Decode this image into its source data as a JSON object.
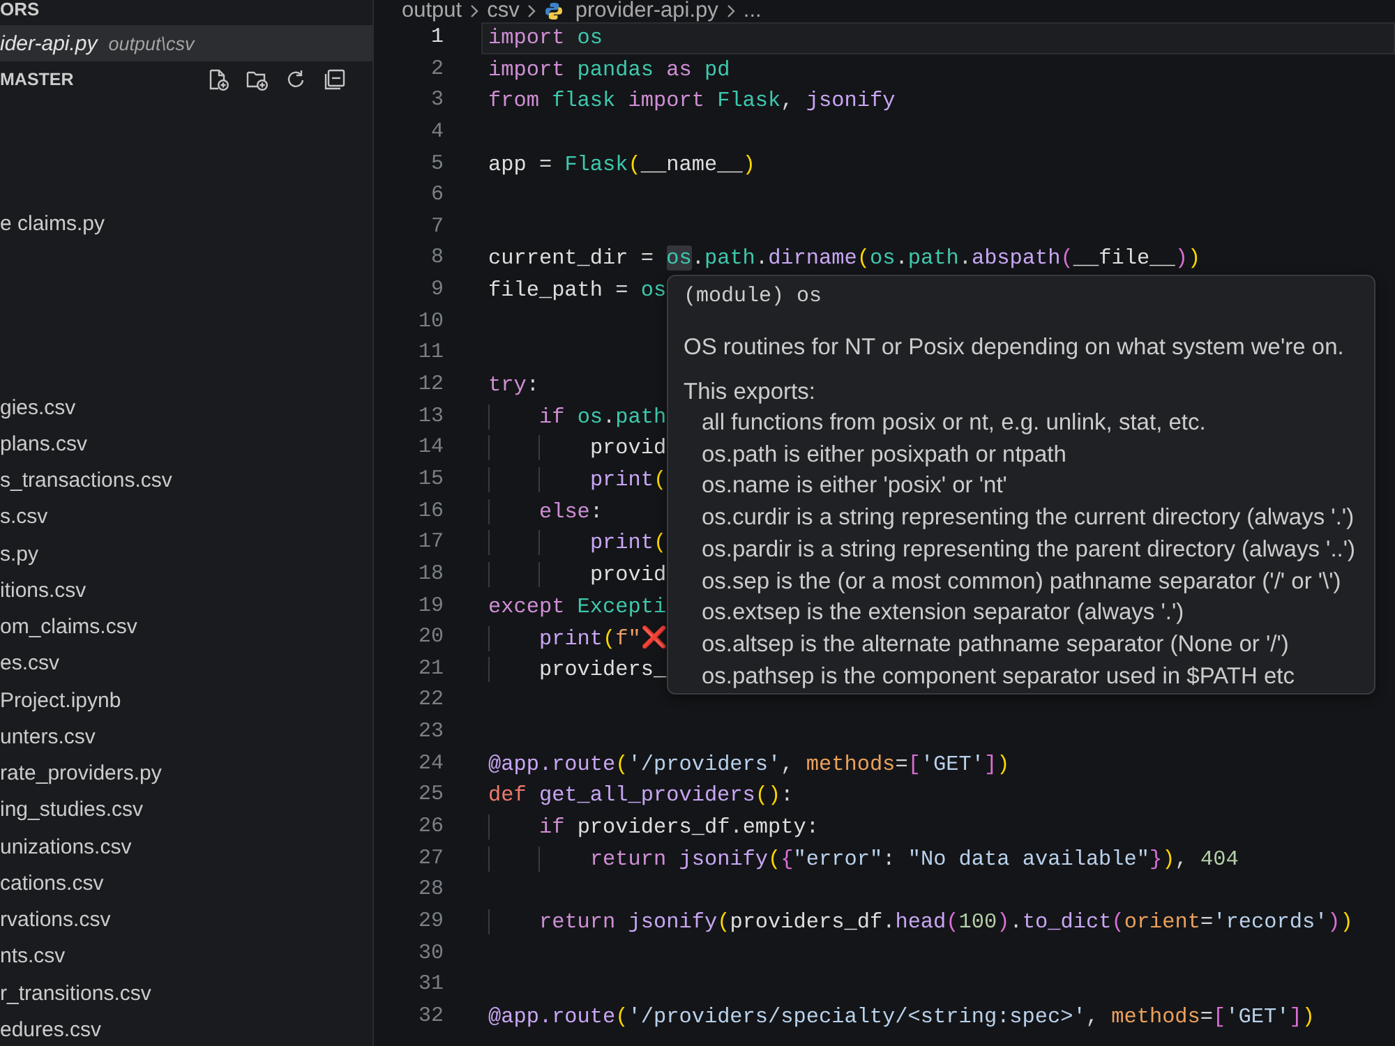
{
  "sidebar": {
    "open_editors": {
      "title": "ORS",
      "items": [
        {
          "name": "ider-api.py",
          "path": "output\\csv",
          "selected": true
        }
      ]
    },
    "explorer": {
      "title": "MASTER",
      "items": [
        "e claims.py",
        "gies.csv",
        "plans.csv",
        "s_transactions.csv",
        "s.csv",
        "s.py",
        "itions.csv",
        "om_claims.csv",
        "es.csv",
        "Project.ipynb",
        "unters.csv",
        "rate_providers.py",
        "ing_studies.csv",
        "unizations.csv",
        "cations.csv",
        "rvations.csv",
        "nts.csv",
        "r_transitions.csv",
        "edures.csv"
      ]
    }
  },
  "editor": {
    "breadcrumbs": [
      {
        "label": "output",
        "kind": "folder"
      },
      {
        "label": "csv",
        "kind": "folder"
      },
      {
        "label": "provider-api.py",
        "kind": "file"
      },
      {
        "label": "...",
        "kind": "more"
      }
    ],
    "lines": [
      {
        "number": "1",
        "current": true,
        "tokens": [
          {
            "text": "import",
            "kind": "keyword"
          },
          {
            "text": " os",
            "kind": "module"
          }
        ]
      },
      {
        "number": "2",
        "current": false,
        "tokens": [
          {
            "text": "import",
            "kind": "keyword"
          },
          {
            "text": " pandas",
            "kind": "module"
          },
          {
            "text": " as",
            "kind": "keyword"
          },
          {
            "text": " pd",
            "kind": "module"
          }
        ]
      },
      {
        "number": "3",
        "current": false,
        "tokens": [
          {
            "text": "from",
            "kind": "keyword"
          },
          {
            "text": " flask",
            "kind": "module"
          },
          {
            "text": " import",
            "kind": "keyword"
          },
          {
            "text": " Flask",
            "kind": "module"
          },
          {
            "text": ", ",
            "kind": "plain"
          },
          {
            "text": "jsonify",
            "kind": "function"
          }
        ]
      },
      {
        "number": "4",
        "current": false
      },
      {
        "number": "5",
        "current": false,
        "tokens": [
          {
            "text": "app",
            "kind": "variable"
          },
          {
            "text": " = ",
            "kind": "plain"
          },
          {
            "text": "Flask",
            "kind": "module"
          },
          {
            "text": "(",
            "kind": "bracket1"
          },
          {
            "text": "__name__",
            "kind": "variable"
          },
          {
            "text": ")",
            "kind": "bracket1"
          }
        ]
      },
      {
        "number": "6",
        "current": false
      },
      {
        "number": "7",
        "current": false
      },
      {
        "number": "8",
        "current": false,
        "tokens": [
          {
            "text": "current_dir",
            "kind": "variable"
          },
          {
            "text": " = ",
            "kind": "plain"
          },
          {
            "text": "os",
            "kind": "hovered"
          },
          {
            "text": ".",
            "kind": "plain"
          },
          {
            "text": "path",
            "kind": "module"
          },
          {
            "text": ".",
            "kind": "plain"
          },
          {
            "text": "dirname",
            "kind": "function"
          },
          {
            "text": "(",
            "kind": "bracket1"
          },
          {
            "text": "os",
            "kind": "module"
          },
          {
            "text": ".",
            "kind": "plain"
          },
          {
            "text": "path",
            "kind": "module"
          },
          {
            "text": ".",
            "kind": "plain"
          },
          {
            "text": "abspath",
            "kind": "function"
          },
          {
            "text": "(",
            "kind": "bracket2"
          },
          {
            "text": "__file__",
            "kind": "variable"
          },
          {
            "text": ")",
            "kind": "bracket2"
          },
          {
            "text": ")",
            "kind": "bracket1"
          }
        ]
      },
      {
        "number": "9",
        "current": false,
        "tokens": [
          {
            "text": "file_path",
            "kind": "variable"
          },
          {
            "text": " = ",
            "kind": "plain"
          },
          {
            "text": "os",
            "kind": "module"
          }
        ]
      },
      {
        "number": "10",
        "current": false
      },
      {
        "number": "11",
        "current": false
      },
      {
        "number": "12",
        "current": false,
        "tokens": [
          {
            "text": "try",
            "kind": "keyword"
          },
          {
            "text": ":",
            "kind": "plain"
          }
        ]
      },
      {
        "number": "13",
        "current": false,
        "tokens": [
          {
            "text": "    if",
            "kind": "keyword"
          },
          {
            "text": " os",
            "kind": "module"
          },
          {
            "text": ".",
            "kind": "plain"
          },
          {
            "text": "path",
            "kind": "module"
          }
        ]
      },
      {
        "number": "14",
        "current": false,
        "tokens": [
          {
            "text": "        provid",
            "kind": "variable"
          }
        ]
      },
      {
        "number": "15",
        "current": false,
        "tokens": [
          {
            "text": "        print",
            "kind": "function"
          },
          {
            "text": "(",
            "kind": "bracket1"
          }
        ]
      },
      {
        "number": "16",
        "current": false,
        "tokens": [
          {
            "text": "    else",
            "kind": "keyword"
          },
          {
            "text": ":",
            "kind": "plain"
          }
        ]
      },
      {
        "number": "17",
        "current": false,
        "tokens": [
          {
            "text": "        print",
            "kind": "function"
          },
          {
            "text": "(",
            "kind": "bracket1"
          }
        ]
      },
      {
        "number": "18",
        "current": false,
        "tokens": [
          {
            "text": "        provid",
            "kind": "variable"
          }
        ]
      },
      {
        "number": "19",
        "current": false,
        "tokens": [
          {
            "text": "except",
            "kind": "keyword"
          },
          {
            "text": " Excepti",
            "kind": "module"
          }
        ]
      },
      {
        "number": "20",
        "current": false,
        "tokens": [
          {
            "text": "    print",
            "kind": "function"
          },
          {
            "text": "(",
            "kind": "bracket1"
          },
          {
            "text": "f\"",
            "kind": "fstring"
          },
          {
            "text": "❌",
            "kind": "emoji"
          }
        ]
      },
      {
        "number": "21",
        "current": false,
        "tokens": [
          {
            "text": "    providers_",
            "kind": "variable"
          }
        ]
      },
      {
        "number": "22",
        "current": false
      },
      {
        "number": "23",
        "current": false
      },
      {
        "number": "24",
        "current": false,
        "tokens": [
          {
            "text": "@app.route",
            "kind": "function"
          },
          {
            "text": "(",
            "kind": "bracket1"
          },
          {
            "text": "'/providers'",
            "kind": "string"
          },
          {
            "text": ", ",
            "kind": "plain"
          },
          {
            "text": "methods",
            "kind": "param"
          },
          {
            "text": "=",
            "kind": "plain"
          },
          {
            "text": "[",
            "kind": "bracket2"
          },
          {
            "text": "'GET'",
            "kind": "string"
          },
          {
            "text": "]",
            "kind": "bracket2"
          },
          {
            "text": ")",
            "kind": "bracket1"
          }
        ]
      },
      {
        "number": "25",
        "current": false,
        "tokens": [
          {
            "text": "def",
            "kind": "def"
          },
          {
            "text": " get_all_providers",
            "kind": "function"
          },
          {
            "text": "(",
            "kind": "bracket1"
          },
          {
            "text": ")",
            "kind": "bracket1"
          },
          {
            "text": ":",
            "kind": "plain"
          }
        ]
      },
      {
        "number": "26",
        "current": false,
        "tokens": [
          {
            "text": "    if",
            "kind": "keyword"
          },
          {
            "text": " providers_df",
            "kind": "variable"
          },
          {
            "text": ".",
            "kind": "plain"
          },
          {
            "text": "empty",
            "kind": "variable"
          },
          {
            "text": ":",
            "kind": "plain"
          }
        ]
      },
      {
        "number": "27",
        "current": false,
        "tokens": [
          {
            "text": "        return",
            "kind": "keyword"
          },
          {
            "text": " jsonify",
            "kind": "function"
          },
          {
            "text": "(",
            "kind": "bracket1"
          },
          {
            "text": "{",
            "kind": "bracket2"
          },
          {
            "text": "\"error\"",
            "kind": "string"
          },
          {
            "text": ": ",
            "kind": "plain"
          },
          {
            "text": "\"No data available\"",
            "kind": "string"
          },
          {
            "text": "}",
            "kind": "bracket2"
          },
          {
            "text": ")",
            "kind": "bracket1"
          },
          {
            "text": ", ",
            "kind": "plain"
          },
          {
            "text": "404",
            "kind": "number"
          }
        ]
      },
      {
        "number": "28",
        "current": false
      },
      {
        "number": "29",
        "current": false,
        "tokens": [
          {
            "text": "    return",
            "kind": "keyword"
          },
          {
            "text": " jsonify",
            "kind": "function"
          },
          {
            "text": "(",
            "kind": "bracket1"
          },
          {
            "text": "providers_df",
            "kind": "variable"
          },
          {
            "text": ".",
            "kind": "plain"
          },
          {
            "text": "head",
            "kind": "function"
          },
          {
            "text": "(",
            "kind": "bracket2"
          },
          {
            "text": "100",
            "kind": "number"
          },
          {
            "text": ")",
            "kind": "bracket2"
          },
          {
            "text": ".",
            "kind": "plain"
          },
          {
            "text": "to_dict",
            "kind": "function"
          },
          {
            "text": "(",
            "kind": "bracket2"
          },
          {
            "text": "orient",
            "kind": "param"
          },
          {
            "text": "=",
            "kind": "plain"
          },
          {
            "text": "'records'",
            "kind": "string"
          },
          {
            "text": ")",
            "kind": "bracket2"
          },
          {
            "text": ")",
            "kind": "bracket1"
          }
        ]
      },
      {
        "number": "30",
        "current": false
      },
      {
        "number": "31",
        "current": false
      },
      {
        "number": "32",
        "current": false,
        "tokens": [
          {
            "text": "@app.route",
            "kind": "function"
          },
          {
            "text": "(",
            "kind": "bracket1"
          },
          {
            "text": "'/providers/specialty/<string:spec>'",
            "kind": "string"
          },
          {
            "text": ", ",
            "kind": "plain"
          },
          {
            "text": "methods",
            "kind": "param"
          },
          {
            "text": "=",
            "kind": "plain"
          },
          {
            "text": "[",
            "kind": "bracket2"
          },
          {
            "text": "'GET'",
            "kind": "string"
          },
          {
            "text": "]",
            "kind": "bracket2"
          },
          {
            "text": ")",
            "kind": "bracket1"
          }
        ]
      }
    ],
    "hover": {
      "signature": "(module) os",
      "summary": "OS routines for NT or Posix depending on what system we're on.",
      "heading": "This exports:",
      "items": [
        "all functions from posix or nt, e.g. unlink, stat, etc.",
        "os.path is either posixpath or ntpath",
        "os.name is either 'posix' or 'nt'",
        "os.curdir is a string representing the current directory (always '.')",
        "os.pardir is a string representing the parent directory (always '..')",
        "os.sep is the (or a most common) pathname separator ('/' or '\\')",
        "os.extsep is the extension separator (always '.')",
        "os.altsep is the alternate pathname separator (None or '/')",
        "os.pathsep is the component separator used in $PATH etc"
      ]
    }
  }
}
